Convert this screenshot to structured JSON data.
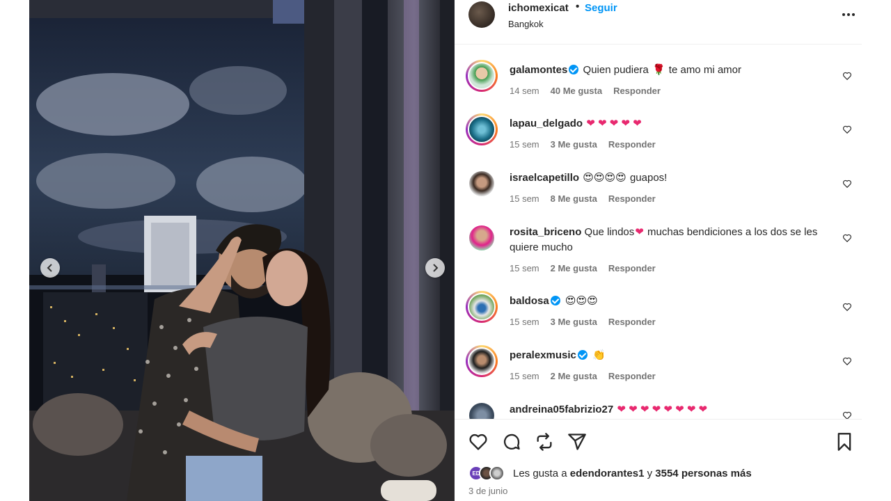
{
  "post": {
    "username": "ichomexicat",
    "separator": "•",
    "follow_label": "Seguir",
    "location": "Bangkok",
    "more_icon": "more-horizontal-icon"
  },
  "comments": [
    {
      "username": "galamontes",
      "verified": true,
      "text": "Quien pudiera",
      "text2": "te amo mi amor",
      "time": "14 sem",
      "likes": "40 Me gusta",
      "reply": "Responder"
    },
    {
      "username": "lapau_delgado",
      "verified": false,
      "text": "",
      "emoji": "❤ ❤ ❤ ❤ ❤",
      "time": "15 sem",
      "likes": "3 Me gusta",
      "reply": "Responder"
    },
    {
      "username": "israelcapetillo",
      "verified": false,
      "emoji": "😍😍😍😍",
      "text": "guapos!",
      "time": "15 sem",
      "likes": "8 Me gusta",
      "reply": "Responder"
    },
    {
      "username": "rosita_briceno",
      "verified": false,
      "text": "Que lindos",
      "text2": "muchas bendiciones a los dos se les quiere mucho",
      "time": "15 sem",
      "likes": "2 Me gusta",
      "reply": "Responder"
    },
    {
      "username": "baldosa",
      "verified": true,
      "emoji": "😍😍😍",
      "time": "15 sem",
      "likes": "3 Me gusta",
      "reply": "Responder"
    },
    {
      "username": "peralexmusic",
      "verified": true,
      "emoji": "👏",
      "time": "15 sem",
      "likes": "2 Me gusta",
      "reply": "Responder"
    },
    {
      "username": "andreina05fabrizio27",
      "verified": false,
      "emoji": "❤ ❤ ❤ ❤ ❤ ❤ ❤ ❤"
    }
  ],
  "footer": {
    "likes_prefix": "Les gusta a",
    "liker_name": "edendorantes1",
    "likes_and": "y",
    "likes_count": "3554 personas más",
    "date": "3 de junio",
    "liker_badge": "ED"
  },
  "colors": {
    "link": "#0095f6",
    "heart_emoji": "#e8296f",
    "text": "#262626",
    "muted": "#737373"
  }
}
